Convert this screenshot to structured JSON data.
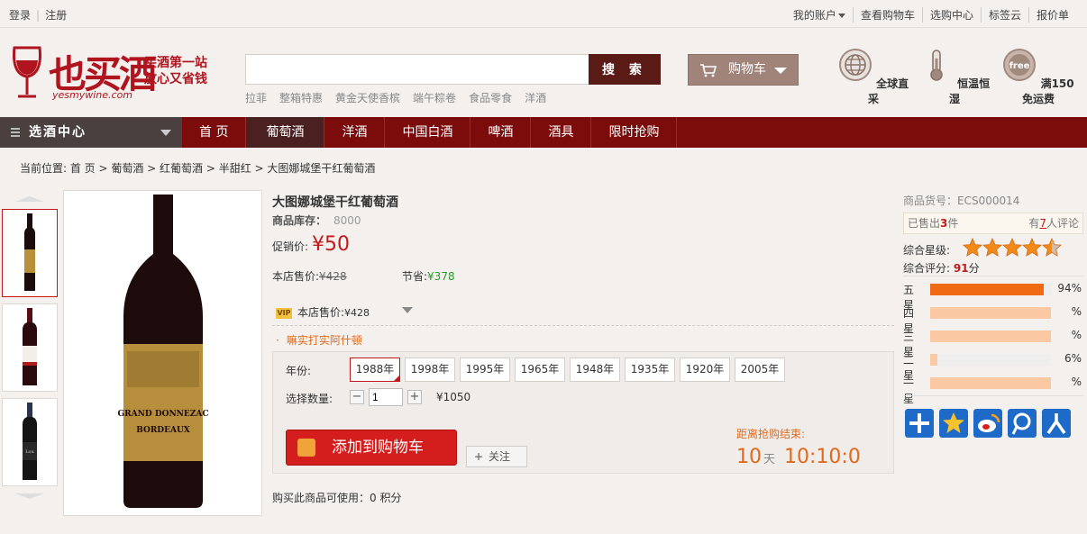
{
  "topbar": {
    "login": "登录",
    "register": "注册",
    "links": [
      {
        "label": "我的账户",
        "dropdown": true
      },
      {
        "label": "查看购物车"
      },
      {
        "label": "选购中心"
      },
      {
        "label": "标签云"
      },
      {
        "label": "报价单"
      }
    ]
  },
  "header": {
    "logo_text": "也买酒",
    "logo_url": "yesmywine.com",
    "slogan_line1": "买酒第一站",
    "slogan_line2": "放心又省钱",
    "search_placeholder": "",
    "search_button": "搜 索",
    "hotwords": [
      "拉菲",
      "整箱特惠",
      "黄金天使香槟",
      "端午粽卷",
      "食品零食",
      "洋酒"
    ],
    "cart_label": "购物车",
    "services": [
      {
        "label": "全球直采",
        "icon": "globe-icon"
      },
      {
        "label": "恒温恒湿",
        "icon": "thermometer-icon"
      },
      {
        "label": "满150免运费",
        "icon": "free-shipping-icon"
      }
    ]
  },
  "nav": {
    "category_label": "选酒中心",
    "items": [
      "首 页",
      "葡萄酒",
      "洋酒",
      "中国白酒",
      "啤酒",
      "酒具",
      "限时抢购"
    ],
    "active_index": 1
  },
  "breadcrumb": "当前位置: 首 页 > 葡萄酒 > 红葡萄酒 > 半甜红 > 大图娜城堡干红葡萄酒",
  "product": {
    "title": "大图娜城堡干红葡萄酒",
    "stock_label": "商品库存：",
    "stock_value": "8000",
    "promo_label": "促销价:",
    "promo_price": "¥50",
    "shop_price_label": "本店售价:",
    "shop_price": "¥428",
    "save_label": "节省:",
    "save_value": "¥378",
    "vip_badge": "VIP",
    "vip_label": "本店售价:",
    "vip_price": "¥428",
    "note": "嘛实打实阿什顿",
    "year_label": "年份:",
    "years": [
      "1988年",
      "1998年",
      "1995年",
      "1965年",
      "1948年",
      "1935年",
      "1920年",
      "2005年"
    ],
    "selected_year_index": 0,
    "qty_label": "选择数量:",
    "qty_value": "1",
    "qty_total": "¥1050",
    "add_to_cart": "添加到购物车",
    "follow": "关注",
    "countdown_label": "距离抢购结束:",
    "countdown_days": "10",
    "countdown_days_unit": "天",
    "countdown_time": "10:10:0",
    "points_text": "购买此商品可使用：0 积分"
  },
  "side": {
    "sku": "商品货号：ECS000014",
    "sold_prefix": "已售出",
    "sold_count": "3",
    "sold_suffix": "件",
    "review_prefix": "有",
    "review_count": "7",
    "review_suffix": "人评论",
    "rating_label": "综合星级:",
    "rating_stars": 4.5,
    "score_label": "综合评分:",
    "score_value": "91",
    "score_unit": "分",
    "bars": [
      {
        "name": "五星",
        "pct_text": "94%",
        "value": 0.94,
        "color": "#f06a14"
      },
      {
        "name": "四星",
        "pct_text": "%",
        "value": 1.0,
        "color": "#fbc8a4"
      },
      {
        "name": "三星",
        "pct_text": "%",
        "value": 1.0,
        "color": "#fbc8a4"
      },
      {
        "name": "二星",
        "pct_text": "6%",
        "value": 0.06,
        "color": "#fbc8a4"
      },
      {
        "name": "一星",
        "pct_text": "%",
        "value": 1.0,
        "color": "#fbc8a4"
      }
    ],
    "share_icons": [
      "add-share-icon",
      "qzone-icon",
      "weibo-icon",
      "tencent-weibo-icon",
      "renren-icon"
    ]
  },
  "colors": {
    "brand_red": "#b0141e",
    "nav_bg": "#7c0c0c",
    "price_red": "#c21a1a",
    "save_green": "#2a9a2a",
    "orange": "#e06a1a"
  }
}
